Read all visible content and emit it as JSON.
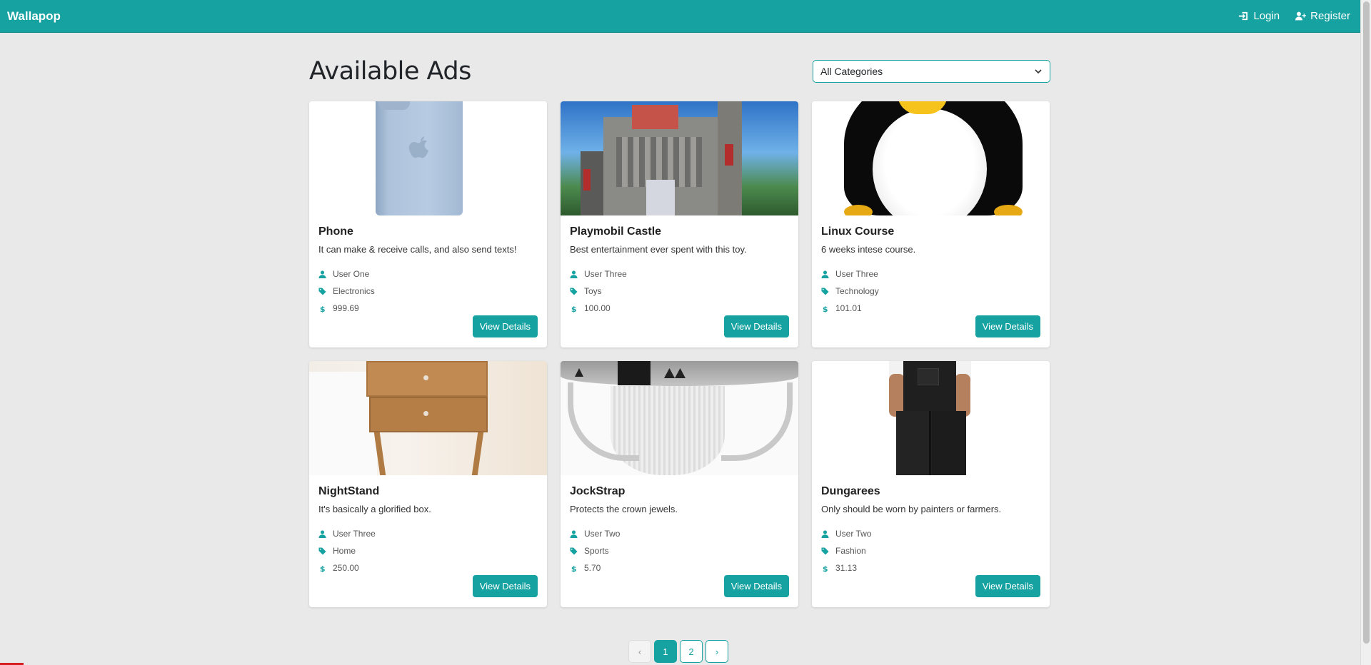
{
  "navbar": {
    "brand": "Wallapop",
    "login_label": "Login",
    "register_label": "Register",
    "color": "#17a2a2"
  },
  "page": {
    "title": "Available Ads"
  },
  "filter": {
    "selected": "All Categories"
  },
  "ads": [
    {
      "title": "Phone",
      "description": "It can make & receive calls, and also send texts!",
      "user": "User One",
      "category": "Electronics",
      "price": "999.69",
      "button": "View Details",
      "image": "phone-image"
    },
    {
      "title": "Playmobil Castle",
      "description": "Best entertainment ever spent with this toy.",
      "user": "User Three",
      "category": "Toys",
      "price": "100.00",
      "button": "View Details",
      "image": "castle-image"
    },
    {
      "title": "Linux Course",
      "description": "6 weeks intese course.",
      "user": "User Three",
      "category": "Technology",
      "price": "101.01",
      "button": "View Details",
      "image": "penguin-image"
    },
    {
      "title": "NightStand",
      "description": "It's basically a glorified box.",
      "user": "User Three",
      "category": "Home",
      "price": "250.00",
      "button": "View Details",
      "image": "nightstand-image"
    },
    {
      "title": "JockStrap",
      "description": "Protects the crown jewels.",
      "user": "User Two",
      "category": "Sports",
      "price": "5.70",
      "button": "View Details",
      "image": "jockstrap-image"
    },
    {
      "title": "Dungarees",
      "description": "Only should be worn by painters or farmers.",
      "user": "User Two",
      "category": "Fashion",
      "price": "31.13",
      "button": "View Details",
      "image": "dungarees-image"
    }
  ],
  "pagination": {
    "prev": "‹",
    "pages": [
      "1",
      "2"
    ],
    "current": "1",
    "next": "›"
  }
}
